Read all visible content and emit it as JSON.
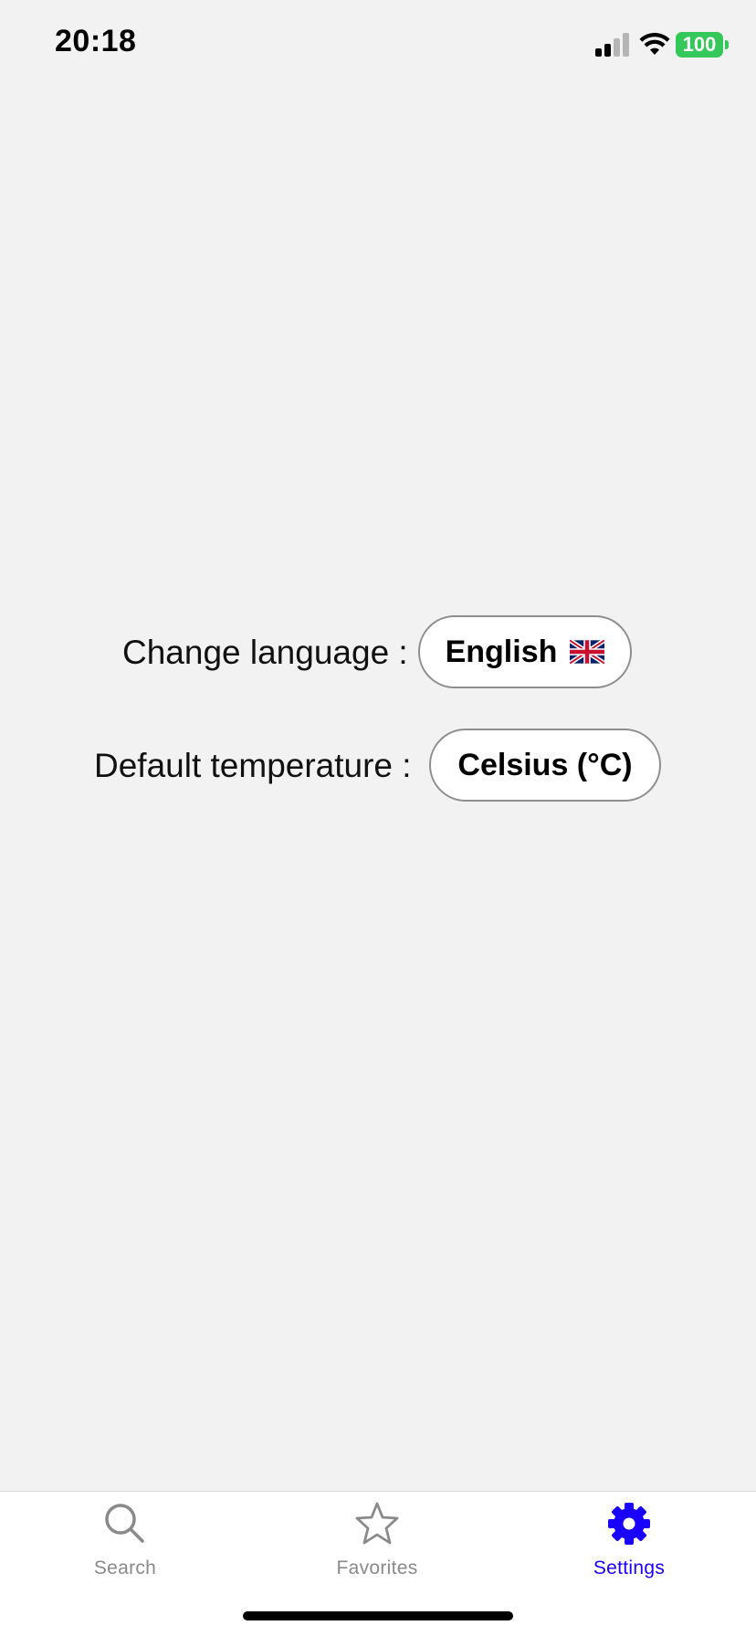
{
  "status_bar": {
    "time": "20:18",
    "battery_level": "100",
    "signal_bars_active": 2,
    "signal_bars_total": 4,
    "battery_color": "#34c759"
  },
  "settings": {
    "language": {
      "label": "Change language :",
      "value": "English",
      "flag_icon": "uk-flag-icon"
    },
    "temperature": {
      "label": "Default temperature :",
      "value": "Celsius (°C)"
    }
  },
  "tab_bar": {
    "active_color": "#1a00ff",
    "inactive_color": "#8a8a8a",
    "tabs": [
      {
        "label": "Search",
        "icon": "search-icon",
        "active": false
      },
      {
        "label": "Favorites",
        "icon": "star-icon",
        "active": false
      },
      {
        "label": "Settings",
        "icon": "gear-icon",
        "active": true
      }
    ]
  }
}
